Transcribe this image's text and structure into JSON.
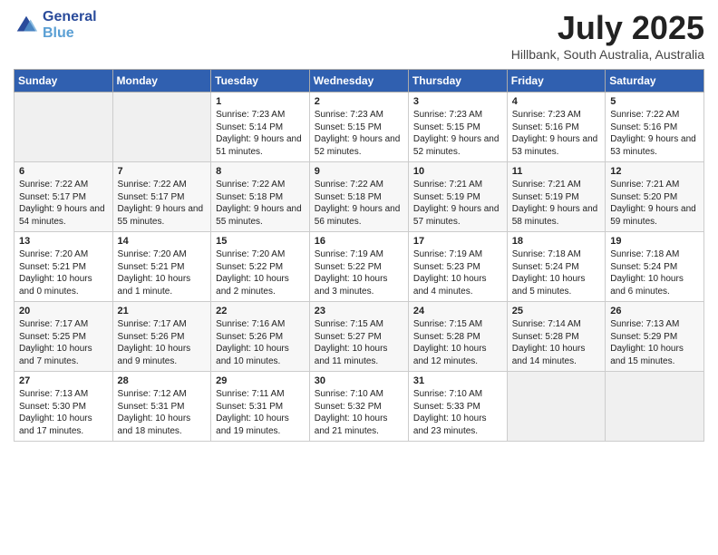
{
  "header": {
    "logo_line1": "General",
    "logo_line2": "Blue",
    "month": "July 2025",
    "location": "Hillbank, South Australia, Australia"
  },
  "weekdays": [
    "Sunday",
    "Monday",
    "Tuesday",
    "Wednesday",
    "Thursday",
    "Friday",
    "Saturday"
  ],
  "weeks": [
    [
      {
        "day": "",
        "info": ""
      },
      {
        "day": "",
        "info": ""
      },
      {
        "day": "1",
        "info": "Sunrise: 7:23 AM\nSunset: 5:14 PM\nDaylight: 9 hours\nand 51 minutes."
      },
      {
        "day": "2",
        "info": "Sunrise: 7:23 AM\nSunset: 5:15 PM\nDaylight: 9 hours\nand 52 minutes."
      },
      {
        "day": "3",
        "info": "Sunrise: 7:23 AM\nSunset: 5:15 PM\nDaylight: 9 hours\nand 52 minutes."
      },
      {
        "day": "4",
        "info": "Sunrise: 7:23 AM\nSunset: 5:16 PM\nDaylight: 9 hours\nand 53 minutes."
      },
      {
        "day": "5",
        "info": "Sunrise: 7:22 AM\nSunset: 5:16 PM\nDaylight: 9 hours\nand 53 minutes."
      }
    ],
    [
      {
        "day": "6",
        "info": "Sunrise: 7:22 AM\nSunset: 5:17 PM\nDaylight: 9 hours\nand 54 minutes."
      },
      {
        "day": "7",
        "info": "Sunrise: 7:22 AM\nSunset: 5:17 PM\nDaylight: 9 hours\nand 55 minutes."
      },
      {
        "day": "8",
        "info": "Sunrise: 7:22 AM\nSunset: 5:18 PM\nDaylight: 9 hours\nand 55 minutes."
      },
      {
        "day": "9",
        "info": "Sunrise: 7:22 AM\nSunset: 5:18 PM\nDaylight: 9 hours\nand 56 minutes."
      },
      {
        "day": "10",
        "info": "Sunrise: 7:21 AM\nSunset: 5:19 PM\nDaylight: 9 hours\nand 57 minutes."
      },
      {
        "day": "11",
        "info": "Sunrise: 7:21 AM\nSunset: 5:19 PM\nDaylight: 9 hours\nand 58 minutes."
      },
      {
        "day": "12",
        "info": "Sunrise: 7:21 AM\nSunset: 5:20 PM\nDaylight: 9 hours\nand 59 minutes."
      }
    ],
    [
      {
        "day": "13",
        "info": "Sunrise: 7:20 AM\nSunset: 5:21 PM\nDaylight: 10 hours\nand 0 minutes."
      },
      {
        "day": "14",
        "info": "Sunrise: 7:20 AM\nSunset: 5:21 PM\nDaylight: 10 hours\nand 1 minute."
      },
      {
        "day": "15",
        "info": "Sunrise: 7:20 AM\nSunset: 5:22 PM\nDaylight: 10 hours\nand 2 minutes."
      },
      {
        "day": "16",
        "info": "Sunrise: 7:19 AM\nSunset: 5:22 PM\nDaylight: 10 hours\nand 3 minutes."
      },
      {
        "day": "17",
        "info": "Sunrise: 7:19 AM\nSunset: 5:23 PM\nDaylight: 10 hours\nand 4 minutes."
      },
      {
        "day": "18",
        "info": "Sunrise: 7:18 AM\nSunset: 5:24 PM\nDaylight: 10 hours\nand 5 minutes."
      },
      {
        "day": "19",
        "info": "Sunrise: 7:18 AM\nSunset: 5:24 PM\nDaylight: 10 hours\nand 6 minutes."
      }
    ],
    [
      {
        "day": "20",
        "info": "Sunrise: 7:17 AM\nSunset: 5:25 PM\nDaylight: 10 hours\nand 7 minutes."
      },
      {
        "day": "21",
        "info": "Sunrise: 7:17 AM\nSunset: 5:26 PM\nDaylight: 10 hours\nand 9 minutes."
      },
      {
        "day": "22",
        "info": "Sunrise: 7:16 AM\nSunset: 5:26 PM\nDaylight: 10 hours\nand 10 minutes."
      },
      {
        "day": "23",
        "info": "Sunrise: 7:15 AM\nSunset: 5:27 PM\nDaylight: 10 hours\nand 11 minutes."
      },
      {
        "day": "24",
        "info": "Sunrise: 7:15 AM\nSunset: 5:28 PM\nDaylight: 10 hours\nand 12 minutes."
      },
      {
        "day": "25",
        "info": "Sunrise: 7:14 AM\nSunset: 5:28 PM\nDaylight: 10 hours\nand 14 minutes."
      },
      {
        "day": "26",
        "info": "Sunrise: 7:13 AM\nSunset: 5:29 PM\nDaylight: 10 hours\nand 15 minutes."
      }
    ],
    [
      {
        "day": "27",
        "info": "Sunrise: 7:13 AM\nSunset: 5:30 PM\nDaylight: 10 hours\nand 17 minutes."
      },
      {
        "day": "28",
        "info": "Sunrise: 7:12 AM\nSunset: 5:31 PM\nDaylight: 10 hours\nand 18 minutes."
      },
      {
        "day": "29",
        "info": "Sunrise: 7:11 AM\nSunset: 5:31 PM\nDaylight: 10 hours\nand 19 minutes."
      },
      {
        "day": "30",
        "info": "Sunrise: 7:10 AM\nSunset: 5:32 PM\nDaylight: 10 hours\nand 21 minutes."
      },
      {
        "day": "31",
        "info": "Sunrise: 7:10 AM\nSunset: 5:33 PM\nDaylight: 10 hours\nand 23 minutes."
      },
      {
        "day": "",
        "info": ""
      },
      {
        "day": "",
        "info": ""
      }
    ]
  ]
}
